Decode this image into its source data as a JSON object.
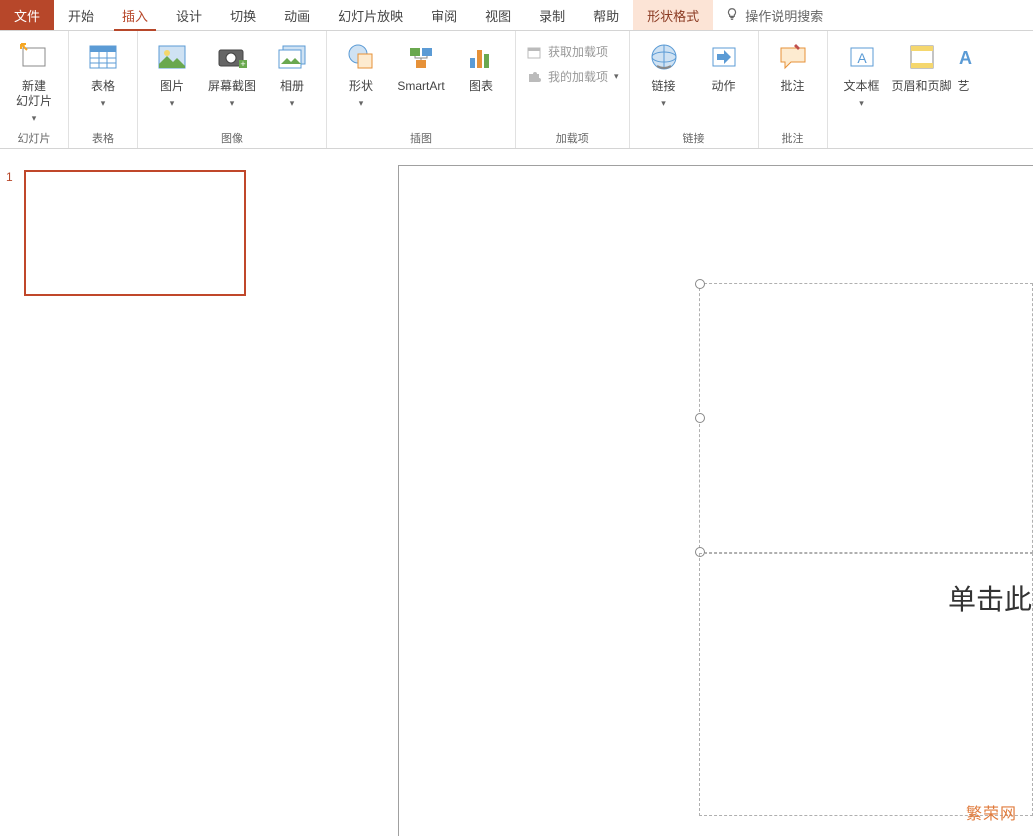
{
  "tabs": {
    "file": "文件",
    "home": "开始",
    "insert": "插入",
    "design": "设计",
    "transitions": "切换",
    "animations": "动画",
    "slideshow": "幻灯片放映",
    "review": "审阅",
    "view": "视图",
    "record": "录制",
    "help": "帮助",
    "shape_format": "形状格式",
    "tell_me": "操作说明搜索"
  },
  "ribbon": {
    "slides": {
      "new_slide": "新建\n幻灯片",
      "group_label": "幻灯片"
    },
    "tables": {
      "table": "表格",
      "group_label": "表格"
    },
    "images": {
      "pictures": "图片",
      "screenshot": "屏幕截图",
      "album": "相册",
      "group_label": "图像"
    },
    "illustrations": {
      "shapes": "形状",
      "smartart": "SmartArt",
      "chart": "图表",
      "group_label": "插图"
    },
    "addins": {
      "get": "获取加载项",
      "my": "我的加载项",
      "group_label": "加载项"
    },
    "links": {
      "link": "链接",
      "action": "动作",
      "group_label": "链接"
    },
    "comments": {
      "comment": "批注",
      "group_label": "批注"
    },
    "text": {
      "textbox": "文本框",
      "header_footer": "页眉和页脚",
      "wordart_partial": "艺"
    }
  },
  "thumbnail": {
    "number": "1"
  },
  "slide": {
    "body_partial": "单击此"
  },
  "watermark": "繁荣网"
}
